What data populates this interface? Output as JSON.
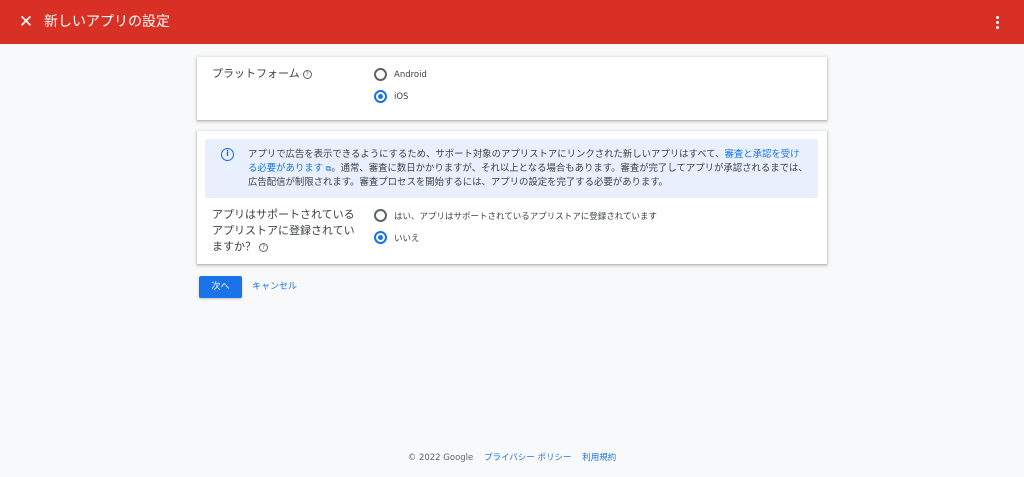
{
  "appbar": {
    "title": "新しいアプリの設定",
    "close_icon": "close-icon",
    "more_icon": "more-vert-icon",
    "color": "#d93025"
  },
  "platform": {
    "label": "プラットフォーム",
    "options": [
      {
        "label": "Android",
        "checked": false
      },
      {
        "label": "iOS",
        "checked": true
      }
    ]
  },
  "info": {
    "text_before": "アプリで広告を表示できるようにするため、サポート対象のアプリストアにリンクされた新しいアプリはすべて、",
    "link": "審査と承認を受ける必要があります",
    "text_after": "。通常、審査に数日かかりますが、それ以上となる場合もあります。審査が完了してアプリが承認されるまでは、広告配信が制限されます。審査プロセスを開始するには、アプリの設定を完了する必要があります。",
    "icon": "info-icon"
  },
  "store": {
    "question": "アプリはサポートされているアプリストアに登録されていますか？",
    "options": [
      {
        "label": "はい、アプリはサポートされているアプリストアに登録されています",
        "checked": false
      },
      {
        "label": "いいえ",
        "checked": true
      }
    ]
  },
  "actions": {
    "next": "次へ",
    "cancel": "キャンセル",
    "accent": "#1a73e8"
  },
  "footer": {
    "copyright": "© 2022 Google",
    "privacy": "プライバシー ポリシー",
    "terms": "利用規約"
  }
}
